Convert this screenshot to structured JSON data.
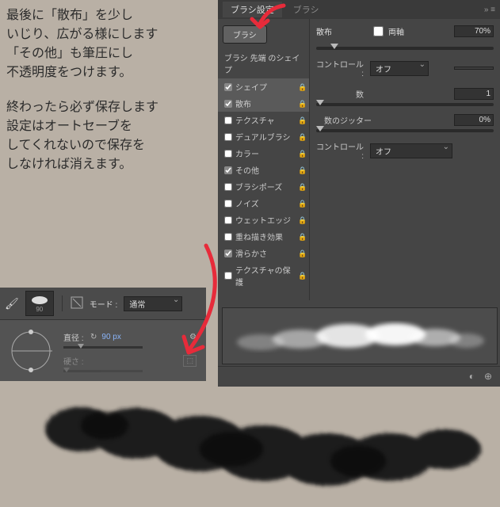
{
  "instructions": {
    "p1": "最後に「散布」を少し\nいじり、広がる様にします\n「その他」も筆圧にし\n不透明度をつけます。",
    "p2": "終わったら必ず保存します\n設定はオートセーブを\nしてくれないので保存を\nしなければ消えます。"
  },
  "brush_panel": {
    "tabs": [
      "ブラシ設定",
      "ブラシ"
    ],
    "header_icons": "»  ≡",
    "brush_button": "ブラシ",
    "left_title": "ブラシ 先端 のシェイプ",
    "options": [
      {
        "label": "シェイプ",
        "checked": true,
        "lock": true,
        "selected": true
      },
      {
        "label": "散布",
        "checked": true,
        "lock": true,
        "selected": true
      },
      {
        "label": "テクスチャ",
        "checked": false,
        "lock": true
      },
      {
        "label": "デュアルブラシ",
        "checked": false,
        "lock": true
      },
      {
        "label": "カラー",
        "checked": false,
        "lock": true
      },
      {
        "label": "その他",
        "checked": true,
        "lock": true
      },
      {
        "label": "ブラシポーズ",
        "checked": false,
        "lock": true
      },
      {
        "label": "ノイズ",
        "checked": false,
        "lock": true
      },
      {
        "label": "ウェットエッジ",
        "checked": false,
        "lock": true
      },
      {
        "label": "重ね描き効果",
        "checked": false,
        "lock": true
      },
      {
        "label": "滑らかさ",
        "checked": true,
        "lock": true
      },
      {
        "label": "テクスチャの保護",
        "checked": false,
        "lock": true
      }
    ],
    "right": {
      "scatter_label": "散布",
      "both_axes_label": "両軸",
      "both_axes_checked": false,
      "scatter_value": "70%",
      "control_label": "コントロール :",
      "control1_value": "オフ",
      "count_label": "数",
      "count_value": "1",
      "count_jitter_label": "数のジッター",
      "count_jitter_value": "0%",
      "control2_value": "オフ"
    }
  },
  "tool_options": {
    "brush_size_thumb": "90",
    "mode_label": "モード :",
    "mode_value": "通常",
    "diameter_label": "直径 :",
    "diameter_value": "90 px",
    "hardness_label": "硬さ :"
  }
}
